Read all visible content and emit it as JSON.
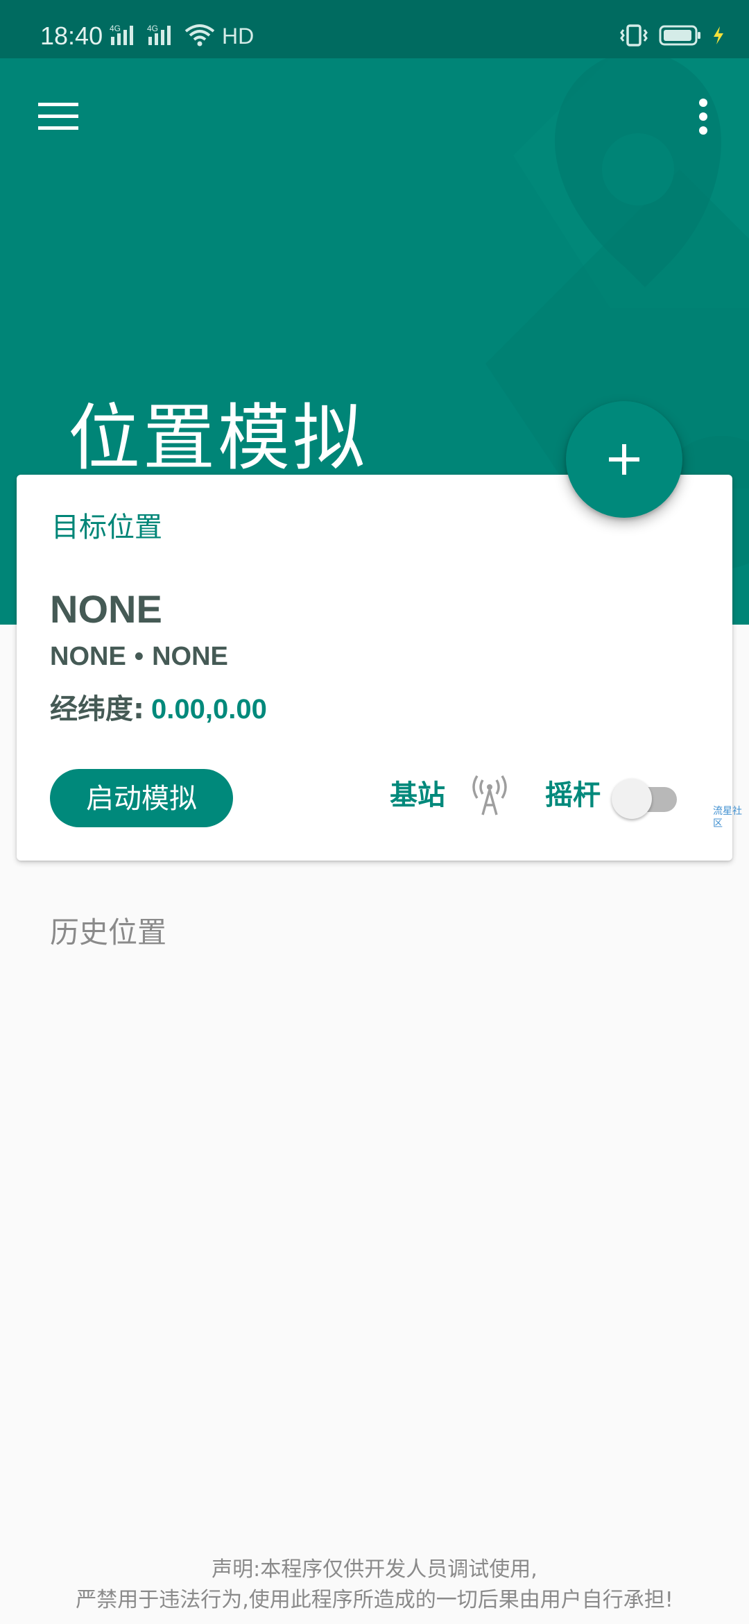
{
  "colors": {
    "primary": "#008577",
    "primary_dark": "#006b60",
    "accent": "#00897b",
    "text_dark": "#455a55",
    "text_muted": "#8a8a8a",
    "background": "#fafafa"
  },
  "status_bar": {
    "time": "18:40",
    "network_1": "4G",
    "network_2": "4G",
    "hd_label": "HD",
    "icons": [
      "signal-4g-icon",
      "signal-4g-icon",
      "wifi-icon",
      "hd-icon",
      "vibrate-icon",
      "battery-icon",
      "charging-icon"
    ]
  },
  "app_bar": {
    "menu_icon": "hamburger-menu-icon",
    "more_icon": "more-vert-icon",
    "title": "位置模拟",
    "background_icon": "location-pin-icon"
  },
  "target_card": {
    "label": "目标位置",
    "place_name": "NONE",
    "place_sub_1": "NONE",
    "place_sub_separator": "•",
    "place_sub_2": "NONE",
    "coords_label": "经纬度:",
    "coords_value": "0.00,0.00",
    "start_button_label": "启动模拟",
    "base_station_label": "基站",
    "base_station_icon": "cell-tower-icon",
    "joystick_label": "摇杆",
    "joystick_enabled": false
  },
  "fab": {
    "icon": "plus-icon"
  },
  "watermark": "流星社区",
  "history": {
    "title": "历史位置"
  },
  "disclaimer": {
    "line1": "声明:本程序仅供开发人员调试使用,",
    "line2": "严禁用于违法行为,使用此程序所造成的一切后果由用户自行承担!"
  }
}
